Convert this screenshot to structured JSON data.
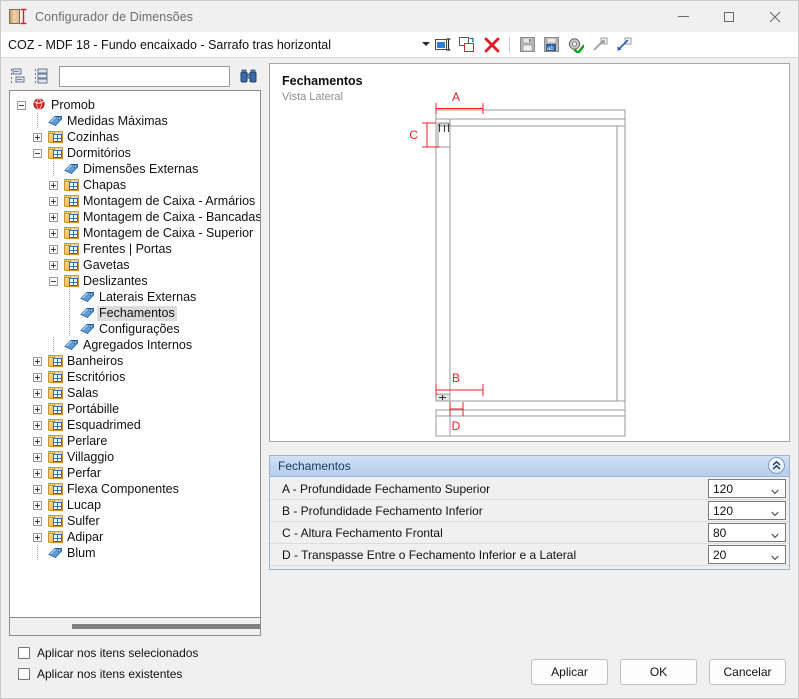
{
  "window": {
    "title": "Configurador de Dimensões",
    "icon": "dimension-config-icon",
    "minimize": "—",
    "maximize": "▢",
    "close": "✕"
  },
  "pathbar": {
    "value": "COZ - MDF 18 - Fundo encaixado - Sarrafo tras horizontal",
    "dropdown_icon": "chevron-down-icon",
    "tools": [
      {
        "name": "rename-item-icon",
        "title": "Renomear"
      },
      {
        "name": "duplicate-item-icon",
        "title": "Duplicar"
      },
      {
        "name": "delete-item-icon",
        "title": "Excluir"
      },
      {
        "name": "save-icon",
        "title": "Salvar"
      },
      {
        "name": "save-as-icon",
        "title": "Salvar como"
      },
      {
        "name": "settings-apply-icon",
        "title": "Aplicar configurações"
      },
      {
        "name": "export-icon",
        "title": "Exportar"
      },
      {
        "name": "import-icon",
        "title": "Importar"
      }
    ]
  },
  "treetoolbar": {
    "collapse_all_icon": "collapse-all-icon",
    "expand_all_icon": "expand-all-icon",
    "search_icon": "binoculars-icon",
    "search_value": "",
    "search_placeholder": ""
  },
  "tree": [
    {
      "label": "Promob",
      "depth": 0,
      "icon": "promob-globe-icon",
      "state": "expanded",
      "selected": false
    },
    {
      "label": "Medidas Máximas",
      "depth": 1,
      "icon": "tag-icon",
      "state": "leaf",
      "selected": false
    },
    {
      "label": "Cozinhas",
      "depth": 1,
      "icon": "folder-icon",
      "state": "collapsed",
      "selected": false
    },
    {
      "label": "Dormitórios",
      "depth": 1,
      "icon": "folder-icon",
      "state": "expanded",
      "selected": false
    },
    {
      "label": "Dimensões Externas",
      "depth": 2,
      "icon": "tag-icon",
      "state": "leaf",
      "selected": false
    },
    {
      "label": "Chapas",
      "depth": 2,
      "icon": "folder-icon",
      "state": "collapsed",
      "selected": false
    },
    {
      "label": "Montagem de Caixa - Armários",
      "depth": 2,
      "icon": "folder-icon",
      "state": "collapsed",
      "selected": false
    },
    {
      "label": "Montagem de Caixa - Bancadas",
      "depth": 2,
      "icon": "folder-icon",
      "state": "collapsed",
      "selected": false
    },
    {
      "label": "Montagem de Caixa - Superior",
      "depth": 2,
      "icon": "folder-icon",
      "state": "collapsed",
      "selected": false
    },
    {
      "label": "Frentes | Portas",
      "depth": 2,
      "icon": "folder-icon",
      "state": "collapsed",
      "selected": false
    },
    {
      "label": "Gavetas",
      "depth": 2,
      "icon": "folder-icon",
      "state": "collapsed",
      "selected": false
    },
    {
      "label": "Deslizantes",
      "depth": 2,
      "icon": "folder-icon",
      "state": "expanded",
      "selected": false
    },
    {
      "label": "Laterais Externas",
      "depth": 3,
      "icon": "tag-icon",
      "state": "leaf",
      "selected": false
    },
    {
      "label": "Fechamentos",
      "depth": 3,
      "icon": "tag-icon",
      "state": "leaf",
      "selected": true
    },
    {
      "label": "Configurações",
      "depth": 3,
      "icon": "tag-icon",
      "state": "leaf",
      "selected": false
    },
    {
      "label": "Agregados Internos",
      "depth": 2,
      "icon": "tag-icon",
      "state": "leaf",
      "selected": false
    },
    {
      "label": "Banheiros",
      "depth": 1,
      "icon": "folder-icon",
      "state": "collapsed",
      "selected": false
    },
    {
      "label": "Escritórios",
      "depth": 1,
      "icon": "folder-icon",
      "state": "collapsed",
      "selected": false
    },
    {
      "label": "Salas",
      "depth": 1,
      "icon": "folder-icon",
      "state": "collapsed",
      "selected": false
    },
    {
      "label": "Portábille",
      "depth": 1,
      "icon": "folder-icon",
      "state": "collapsed",
      "selected": false
    },
    {
      "label": "Esquadrimed",
      "depth": 1,
      "icon": "folder-icon",
      "state": "collapsed",
      "selected": false
    },
    {
      "label": "Perlare",
      "depth": 1,
      "icon": "folder-icon",
      "state": "collapsed",
      "selected": false
    },
    {
      "label": "Villaggio",
      "depth": 1,
      "icon": "folder-icon",
      "state": "collapsed",
      "selected": false
    },
    {
      "label": "Perfar",
      "depth": 1,
      "icon": "folder-icon",
      "state": "collapsed",
      "selected": false
    },
    {
      "label": "Flexa Componentes",
      "depth": 1,
      "icon": "folder-icon",
      "state": "collapsed",
      "selected": false
    },
    {
      "label": "Lucap",
      "depth": 1,
      "icon": "folder-icon",
      "state": "collapsed",
      "selected": false
    },
    {
      "label": "Sulfer",
      "depth": 1,
      "icon": "folder-icon",
      "state": "collapsed",
      "selected": false
    },
    {
      "label": "Adipar",
      "depth": 1,
      "icon": "folder-icon",
      "state": "collapsed",
      "selected": false
    },
    {
      "label": "Blum",
      "depth": 1,
      "icon": "tag-icon",
      "state": "leaf",
      "selected": false
    }
  ],
  "drawing": {
    "title": "Fechamentos",
    "subtitle": "Vista Lateral",
    "dimension_color": "#ee1c24",
    "line_color": "#9a9a9a",
    "labels": [
      "A",
      "C",
      "B",
      "D"
    ]
  },
  "properties": {
    "header": "Fechamentos",
    "collapse_icon": "collapse-chevron-up-icon",
    "rows": [
      {
        "label": "A - Profundidade Fechamento Superior",
        "value": "120"
      },
      {
        "label": "B - Profundidade Fechamento Inferior",
        "value": "120"
      },
      {
        "label": "C - Altura Fechamento Frontal",
        "value": "80"
      },
      {
        "label": "D - Transpasse Entre o Fechamento Inferior e a Lateral",
        "value": "20"
      }
    ]
  },
  "footer": {
    "checkboxes": [
      {
        "label": "Aplicar nos itens selecionados",
        "checked": false
      },
      {
        "label": "Aplicar nos itens existentes",
        "checked": false
      }
    ],
    "buttons": [
      {
        "label": "Aplicar"
      },
      {
        "label": "OK"
      },
      {
        "label": "Cancelar"
      }
    ]
  }
}
